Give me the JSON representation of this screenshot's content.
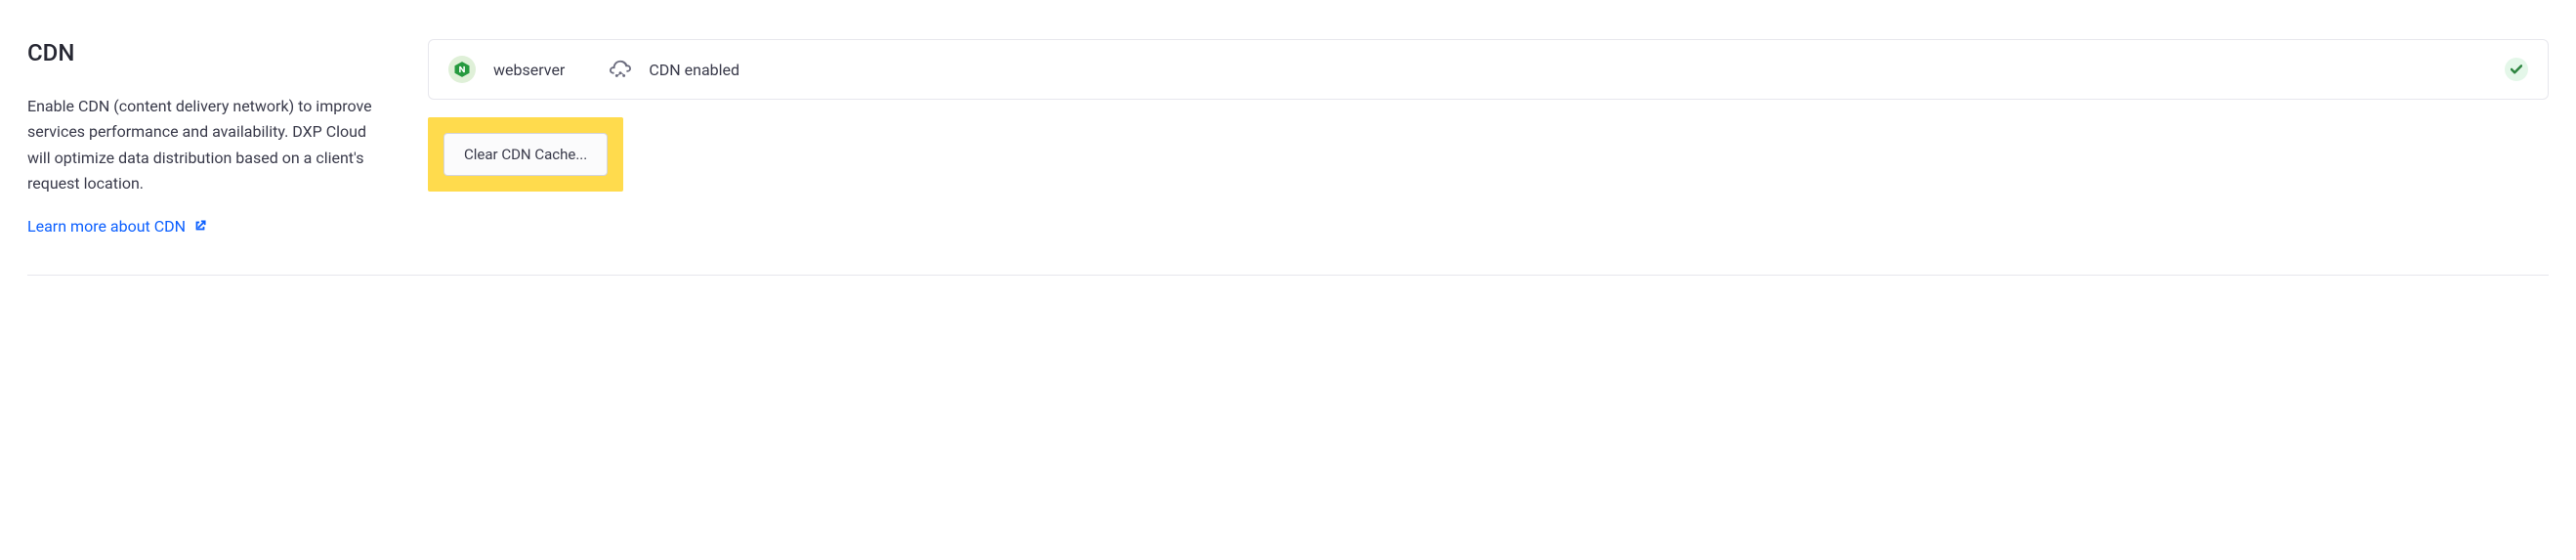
{
  "section": {
    "title": "CDN",
    "description": "Enable CDN (content delivery network) to improve services performance and availability. DXP Cloud will optimize data distribution based on a client's request location.",
    "learn_more_label": "Learn more about CDN"
  },
  "service_card": {
    "service_name": "webserver",
    "status_label": "CDN enabled"
  },
  "actions": {
    "clear_cache_label": "Clear CDN Cache..."
  },
  "colors": {
    "link": "#0b5fff",
    "highlight": "#ffdb4d",
    "success_bg": "#e4f7e9",
    "success_fg": "#2e8540",
    "nginx_bg": "#dff0d8",
    "nginx_fg": "#269a3f"
  }
}
